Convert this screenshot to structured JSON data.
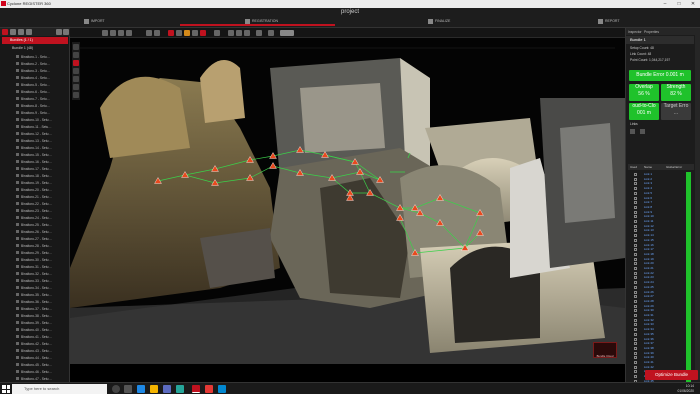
{
  "window": {
    "title": "Cyclone REGISTER 360",
    "min": "–",
    "max": "□",
    "close": "✕"
  },
  "ribbon": {
    "project_title": "project",
    "steps": [
      {
        "label": "IMPORT"
      },
      {
        "label": "REGISTRATION"
      },
      {
        "label": "FINALIZE"
      },
      {
        "label": "REPORT"
      }
    ]
  },
  "tree": {
    "root_label": "Bundles (1 / 1)",
    "bundle_label": "Bundle 1 (48)",
    "scans": [
      "Binaltoro-1 - Setu…",
      "Binaltoro-2 - Setu…",
      "Binaltoro-3 - Setu…",
      "Binaltoro-4 - Setu…",
      "Binaltoro-5 - Setu…",
      "Binaltoro-6 - Setu…",
      "Binaltoro-7 - Setu…",
      "Binaltoro-8 - Setu…",
      "Binaltoro-9 - Setu…",
      "Binaltoro-10 - Setu…",
      "Binaltoro-11 - Setu…",
      "Binaltoro-12 - Setu…",
      "Binaltoro-13 - Setu…",
      "Binaltoro-14 - Setu…",
      "Binaltoro-15 - Setu…",
      "Binaltoro-16 - Setu…",
      "Binaltoro-17 - Setu…",
      "Binaltoro-18 - Setu…",
      "Binaltoro-19 - Setu…",
      "Binaltoro-20 - Setu…",
      "Binaltoro-21 - Setu…",
      "Binaltoro-22 - Setu…",
      "Binaltoro-23 - Setu…",
      "Binaltoro-24 - Setu…",
      "Binaltoro-25 - Setu…",
      "Binaltoro-26 - Setu…",
      "Binaltoro-27 - Setu…",
      "Binaltoro-28 - Setu…",
      "Binaltoro-29 - Setu…",
      "Binaltoro-30 - Setu…",
      "Binaltoro-31 - Setu…",
      "Binaltoro-32 - Setu…",
      "Binaltoro-33 - Setu…",
      "Binaltoro-34 - Setu…",
      "Binaltoro-35 - Setu…",
      "Binaltoro-36 - Setu…",
      "Binaltoro-37 - Setu…",
      "Binaltoro-38 - Setu…",
      "Binaltoro-39 - Setu…",
      "Binaltoro-40 - Setu…",
      "Binaltoro-41 - Setu…",
      "Binaltoro-42 - Setu…",
      "Binaltoro-43 - Setu…",
      "Binaltoro-44 - Setu…",
      "Binaltoro-45 - Setu…",
      "Binaltoro-46 - Setu…",
      "Binaltoro-47 - Setu…"
    ]
  },
  "viewport": {
    "brand_label": "Bundle Cloud"
  },
  "right_panel": {
    "tab_inspector": "Inspector",
    "tab_properties": "Properties",
    "header": "Bundle 1",
    "setup_count": "Setup Count:  48",
    "link_count": "Link Count:  48",
    "point_count": "Point Count:  1,044,217,197",
    "bundle_error": "Bundle Error 0.001 m",
    "overlap_label": "Overlap",
    "overlap_value": "56 %",
    "strength_label": "Strength",
    "strength_value": "82 %",
    "c2c_label": "oud-to-Clo",
    "c2c_value": "001 m",
    "target_label": "Target Erro",
    "target_value": "...",
    "links_title": "Links",
    "table_headers": [
      "Used",
      "Name",
      "Global Error"
    ],
    "rows": [
      "Link 1",
      "Link 2",
      "Link 3",
      "Link 4",
      "Link 5",
      "Link 6",
      "Link 7",
      "Link 8",
      "Link 9",
      "Link 10",
      "Link 11",
      "Link 12",
      "Link 13",
      "Link 14",
      "Link 15",
      "Link 16",
      "Link 17",
      "Link 18",
      "Link 19",
      "Link 20",
      "Link 21",
      "Link 22",
      "Link 23",
      "Link 24",
      "Link 25",
      "Link 26",
      "Link 27",
      "Link 28",
      "Link 29",
      "Link 30",
      "Link 31",
      "Link 32",
      "Link 33",
      "Link 34",
      "Link 35",
      "Link 36",
      "Link 37",
      "Link 38",
      "Link 39",
      "Link 40",
      "Link 41",
      "Link 42",
      "Link 43",
      "Link 44",
      "Link 45",
      "Link 46"
    ],
    "optimize_label": "Optimize Bundle"
  },
  "taskbar": {
    "search_placeholder": "Type here to search",
    "time": "10:14",
    "date": "01/06/2020"
  },
  "colors": {
    "accent_red": "#c0121f",
    "ok_green": "#1fc22b",
    "warning_orange": "#e8491e"
  }
}
